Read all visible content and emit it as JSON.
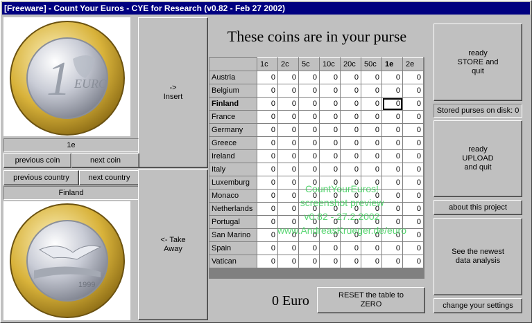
{
  "window": {
    "title": "[Freeware] - Count Your Euros - CYE for Research (v0.82 - Feb 27 2002)"
  },
  "left": {
    "coin_label": "1e",
    "prev_coin": "previous coin",
    "next_coin": "next coin",
    "prev_country": "previous country",
    "next_country": "next country",
    "country_label": "Finland",
    "insert_label": "-> Insert",
    "takeaway_label": "<- Take Away"
  },
  "main": {
    "heading": "These coins are in your purse",
    "columns": [
      "1c",
      "2c",
      "5c",
      "10c",
      "20c",
      "50c",
      "1e",
      "2e"
    ],
    "selected_column": "1e",
    "rows": [
      {
        "country": "Austria",
        "values": [
          "0",
          "0",
          "0",
          "0",
          "0",
          "0",
          "0",
          "0"
        ]
      },
      {
        "country": "Belgium",
        "values": [
          "0",
          "0",
          "0",
          "0",
          "0",
          "0",
          "0",
          "0"
        ]
      },
      {
        "country": "Finland",
        "values": [
          "0",
          "0",
          "0",
          "0",
          "0",
          "0",
          "0",
          "0"
        ]
      },
      {
        "country": "France",
        "values": [
          "0",
          "0",
          "0",
          "0",
          "0",
          "0",
          "0",
          "0"
        ]
      },
      {
        "country": "Germany",
        "values": [
          "0",
          "0",
          "0",
          "0",
          "0",
          "0",
          "0",
          "0"
        ]
      },
      {
        "country": "Greece",
        "values": [
          "0",
          "0",
          "0",
          "0",
          "0",
          "0",
          "0",
          "0"
        ]
      },
      {
        "country": "Ireland",
        "values": [
          "0",
          "0",
          "0",
          "0",
          "0",
          "0",
          "0",
          "0"
        ]
      },
      {
        "country": "Italy",
        "values": [
          "0",
          "0",
          "0",
          "0",
          "0",
          "0",
          "0",
          "0"
        ]
      },
      {
        "country": "Luxemburg",
        "values": [
          "0",
          "0",
          "0",
          "0",
          "0",
          "0",
          "0",
          "0"
        ]
      },
      {
        "country": "Monaco",
        "values": [
          "0",
          "0",
          "0",
          "0",
          "0",
          "0",
          "0",
          "0"
        ]
      },
      {
        "country": "Netherlands",
        "values": [
          "0",
          "0",
          "0",
          "0",
          "0",
          "0",
          "0",
          "0"
        ]
      },
      {
        "country": "Portugal",
        "values": [
          "0",
          "0",
          "0",
          "0",
          "0",
          "0",
          "0",
          "0"
        ]
      },
      {
        "country": "San Marino",
        "values": [
          "0",
          "0",
          "0",
          "0",
          "0",
          "0",
          "0",
          "0"
        ]
      },
      {
        "country": "Spain",
        "values": [
          "0",
          "0",
          "0",
          "0",
          "0",
          "0",
          "0",
          "0"
        ]
      },
      {
        "country": "Vatican",
        "values": [
          "0",
          "0",
          "0",
          "0",
          "0",
          "0",
          "0",
          "0"
        ]
      }
    ],
    "selected_row": "Finland",
    "watermark": [
      "CountYourEuros!",
      "screenshot preview",
      "v0.82 - 27.2.2002",
      "www.AndreasKrueger.de/euro"
    ],
    "total": "0 Euro",
    "reset_label": "RESET the table to ZERO"
  },
  "right": {
    "store_label": "ready STORE and quit",
    "stored_count": "Stored purses on disk: 0",
    "upload_label": "ready UPLOAD and quit",
    "about_label": "about this project",
    "analysis_label": "See the newest data analysis",
    "settings_label": "change your settings"
  },
  "colors": {
    "titlebar": "#000080",
    "face": "#c0c0c0",
    "watermark": "#3ccf5a"
  },
  "coin_obverse_text": "1 EURO",
  "coin_reverse_text": "1999"
}
